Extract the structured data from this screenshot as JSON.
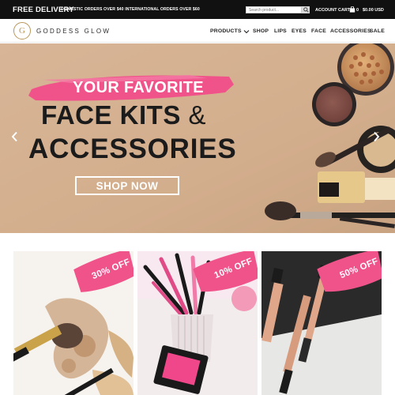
{
  "topbar": {
    "free_delivery": "FREE DELIVERY",
    "promo": "DOMESTIC ORDERS OVER $40 INTERNATIONAL ORDERS OVER $60",
    "search_placeholder": "Search product...",
    "account": "ACCOUNT",
    "cart": "CART",
    "cart_count": "0",
    "cart_total": "$0.00 USD",
    "search_icon": "search-icon",
    "cart_icon": "shopping-bag-icon"
  },
  "header": {
    "logo_letter": "G",
    "brand": "GODDESS GLOW",
    "nav": [
      {
        "label": "PRODUCTS",
        "has_dropdown": true
      },
      {
        "label": "SHOP"
      },
      {
        "label": "LIPS"
      },
      {
        "label": "EYES"
      },
      {
        "label": "FACE"
      },
      {
        "label": "ACCESSORIES"
      },
      {
        "label": "SALE"
      }
    ]
  },
  "hero": {
    "line1": "YOUR FAVORITE",
    "line2": "FACE KITS",
    "amp": "&",
    "line3": "ACCESSORIES",
    "cta": "SHOP NOW",
    "prev_icon": "chevron-left-icon",
    "next_icon": "chevron-right-icon"
  },
  "products": [
    {
      "discount": "30% OFF"
    },
    {
      "discount": "10% OFF"
    },
    {
      "discount": "50% OFF"
    }
  ],
  "colors": {
    "topbar_bg": "#111111",
    "accent_pink": "#f0538a",
    "gold": "#b9975b",
    "hero_bg": "#d5b294"
  }
}
